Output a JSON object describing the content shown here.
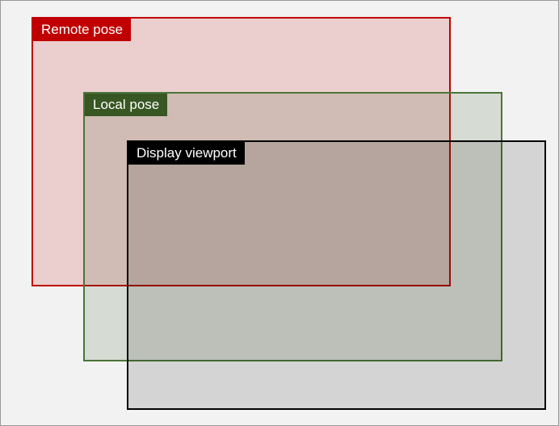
{
  "boxes": {
    "remote": {
      "label": "Remote pose"
    },
    "local": {
      "label": "Local pose"
    },
    "viewport": {
      "label": "Display viewport"
    }
  }
}
